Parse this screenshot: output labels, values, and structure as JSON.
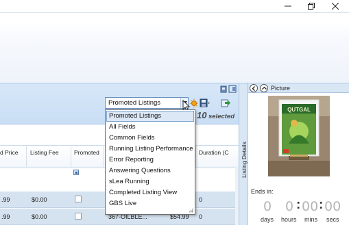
{
  "window": {
    "minimize_icon": "minimize-icon",
    "restore_icon": "restore-icon",
    "close_icon": "close-icon"
  },
  "toolbar": {
    "view_selector": {
      "selected": "Promoted Listings",
      "options": [
        "Promoted Listings",
        "All Fields",
        "Common Fields",
        "Running Listing Performance",
        "Error Reporting",
        "Answering Questions",
        "sLea Running",
        "Completed Listing View",
        "GBS Live"
      ]
    },
    "selected_count": "10",
    "selected_label": "selected"
  },
  "grid": {
    "columns": [
      "d Price",
      "Listing Fee",
      "Promoted",
      "Duration (C"
    ],
    "rows": [
      {
        "price": ".99",
        "fee": "$0.00",
        "promoted": false,
        "sku": "",
        "start_price": "",
        "duration": "0"
      },
      {
        "price": ".99",
        "fee": "$0.00",
        "promoted": false,
        "sku": "367-OILBLE...",
        "start_price": "$54.99",
        "duration": "0"
      }
    ]
  },
  "side_tab": {
    "label": "Listing Details"
  },
  "detail_panel": {
    "title": "Picture",
    "ends_in_label": "Ends in:",
    "countdown": {
      "days": "0",
      "hours": "0",
      "mins": "00",
      "secs": "00",
      "days_label": "days",
      "hours_label": "hours",
      "mins_label": "mins",
      "secs_label": "secs"
    }
  },
  "colors": {
    "accent": "#6b8fbf",
    "row_bg": "#d5e2ef",
    "band": "#d7e7f8"
  }
}
